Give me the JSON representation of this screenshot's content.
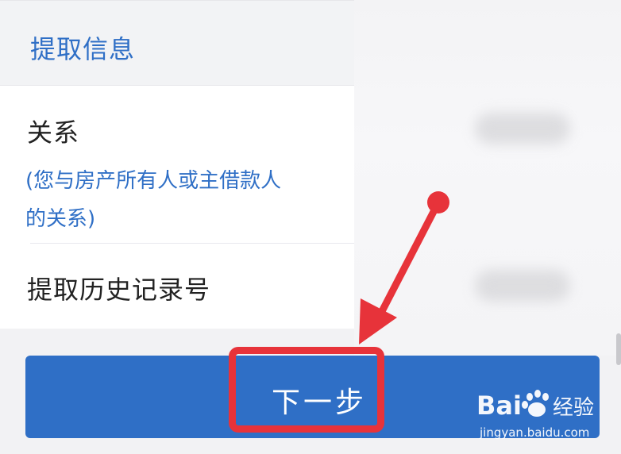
{
  "section": {
    "title": "提取信息"
  },
  "form": {
    "relation": {
      "label": "关系",
      "hint": "(您与房产所有人或主借款人的关系)"
    },
    "history": {
      "label": "提取历史记录号"
    }
  },
  "actions": {
    "next_label": "下一步"
  },
  "annotation": {
    "highlight_color": "#e7333a",
    "arrow_color": "#e7333a"
  },
  "watermark": {
    "logo_text": "Bai经验",
    "url": "jingyan.baidu.com"
  },
  "colors": {
    "accent": "#2f6fc6",
    "page_bg": "#f2f2f4",
    "card_bg": "#ffffff"
  }
}
